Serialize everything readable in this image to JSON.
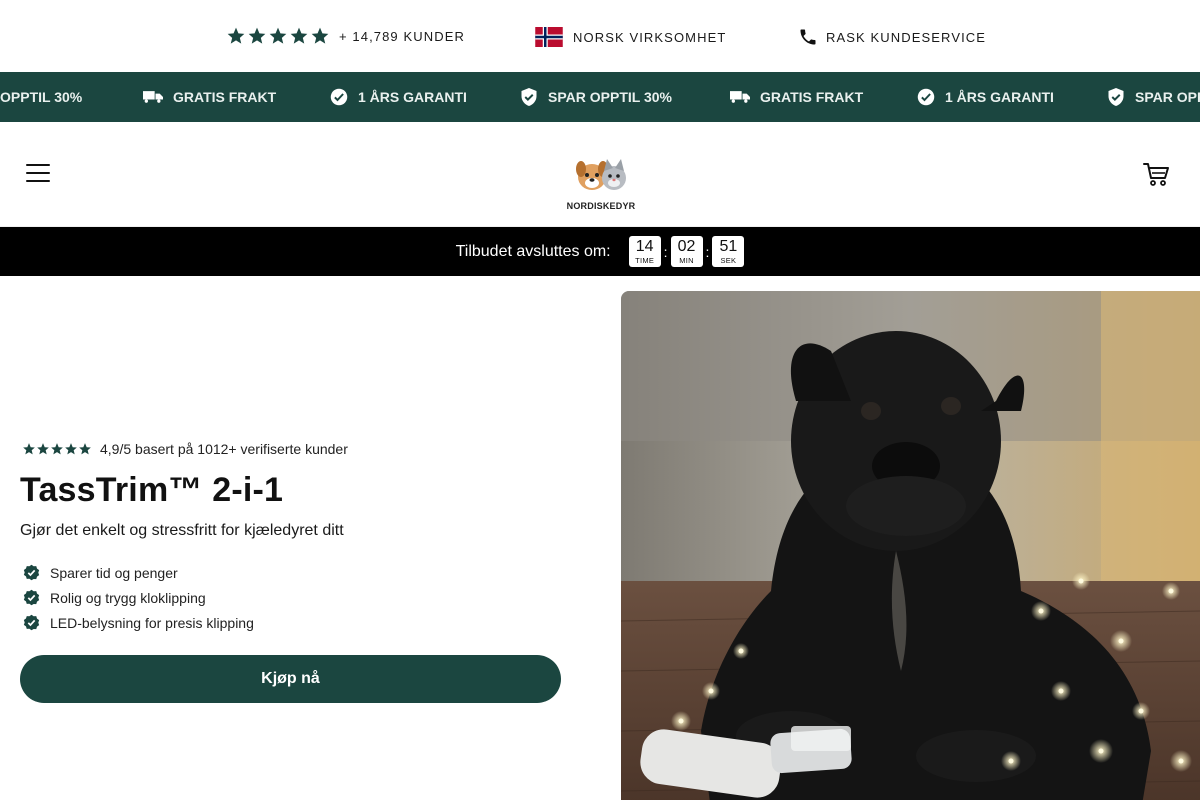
{
  "trust_bar": {
    "customers": "+ 14,789 KUNDER",
    "norwegian": "NORSK VIRKSOMHET",
    "service": "RASK KUNDESERVICE"
  },
  "marquee": {
    "items": [
      "OPPTIL 30%",
      "GRATIS FRAKT",
      "1 ÅRS GARANTI",
      "SPAR OPPTIL 30%",
      "GRATIS FRAKT",
      "1 ÅRS GARANTI",
      "SPAR OPP"
    ]
  },
  "header": {
    "logo_text": "NORDISKEDYR"
  },
  "countdown": {
    "label": "Tilbudet avsluttes om:",
    "hours": "14",
    "hours_unit": "TIME",
    "minutes": "02",
    "minutes_unit": "MIN",
    "seconds": "51",
    "seconds_unit": "SEK",
    "separator": ":"
  },
  "hero": {
    "rating_text": "4,9/5 basert på 1012+ verifiserte kunder",
    "title": "TassTrim™ 2-i-1",
    "subtitle": "Gjør det enkelt og stressfritt for kjæledyret ditt",
    "features": [
      "Sparer tid og penger",
      "Rolig og trygg kloklipping",
      "LED-belysning for presis klipping"
    ],
    "cta": "Kjøp nå"
  },
  "colors": {
    "brand": "#1b4640",
    "countdown_bg": "#000000"
  }
}
